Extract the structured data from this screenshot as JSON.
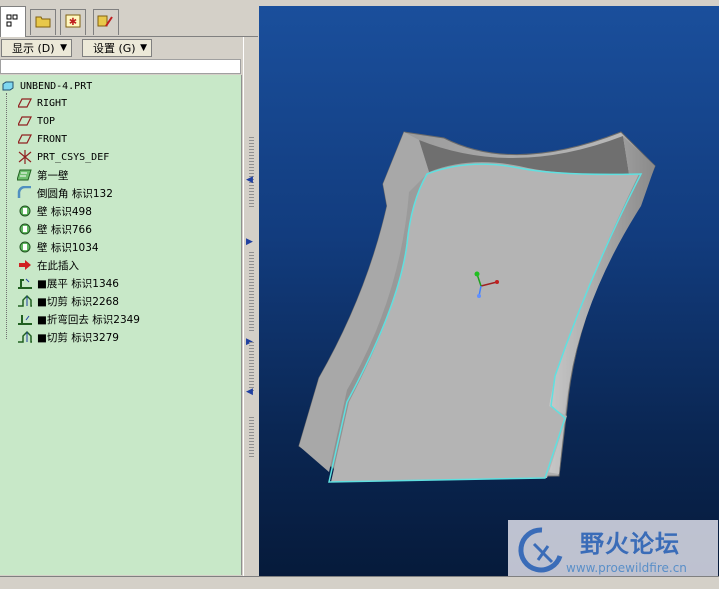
{
  "toolbar": {
    "display_label": "显示 (D)",
    "settings_label": "设置 (G)"
  },
  "tree": {
    "root": "UNBEND-4.PRT",
    "items": [
      {
        "label": "RIGHT",
        "icon": "datum-plane-icon"
      },
      {
        "label": "TOP",
        "icon": "datum-plane-icon"
      },
      {
        "label": "FRONT",
        "icon": "datum-plane-icon"
      },
      {
        "label": "PRT_CSYS_DEF",
        "icon": "csys-icon"
      },
      {
        "label": "第一壁",
        "icon": "first-wall-icon"
      },
      {
        "label": "倒圆角 标识132",
        "icon": "round-icon"
      },
      {
        "label": "壁 标识498",
        "icon": "wall-icon"
      },
      {
        "label": "壁 标识766",
        "icon": "wall-icon"
      },
      {
        "label": "壁 标识1034",
        "icon": "wall-icon"
      },
      {
        "label": "在此插入",
        "icon": "insert-here-arrow-icon"
      },
      {
        "label": "■展平 标识1346",
        "icon": "unbend-icon"
      },
      {
        "label": "■切剪 标识2268",
        "icon": "cut-icon"
      },
      {
        "label": "■折弯回去 标识2349",
        "icon": "bend-back-icon"
      },
      {
        "label": "■切剪 标识3279",
        "icon": "cut-icon"
      }
    ]
  },
  "watermark": {
    "title": "野火论坛",
    "url": "www.proewildfire.cn"
  },
  "colors": {
    "tree_bg": "#c8e8c8",
    "viewport_top": "#1a4f9c",
    "viewport_bottom": "#061a3a",
    "part_gray": "#b4b4b4",
    "edge_highlight": "#5fe0e0"
  }
}
